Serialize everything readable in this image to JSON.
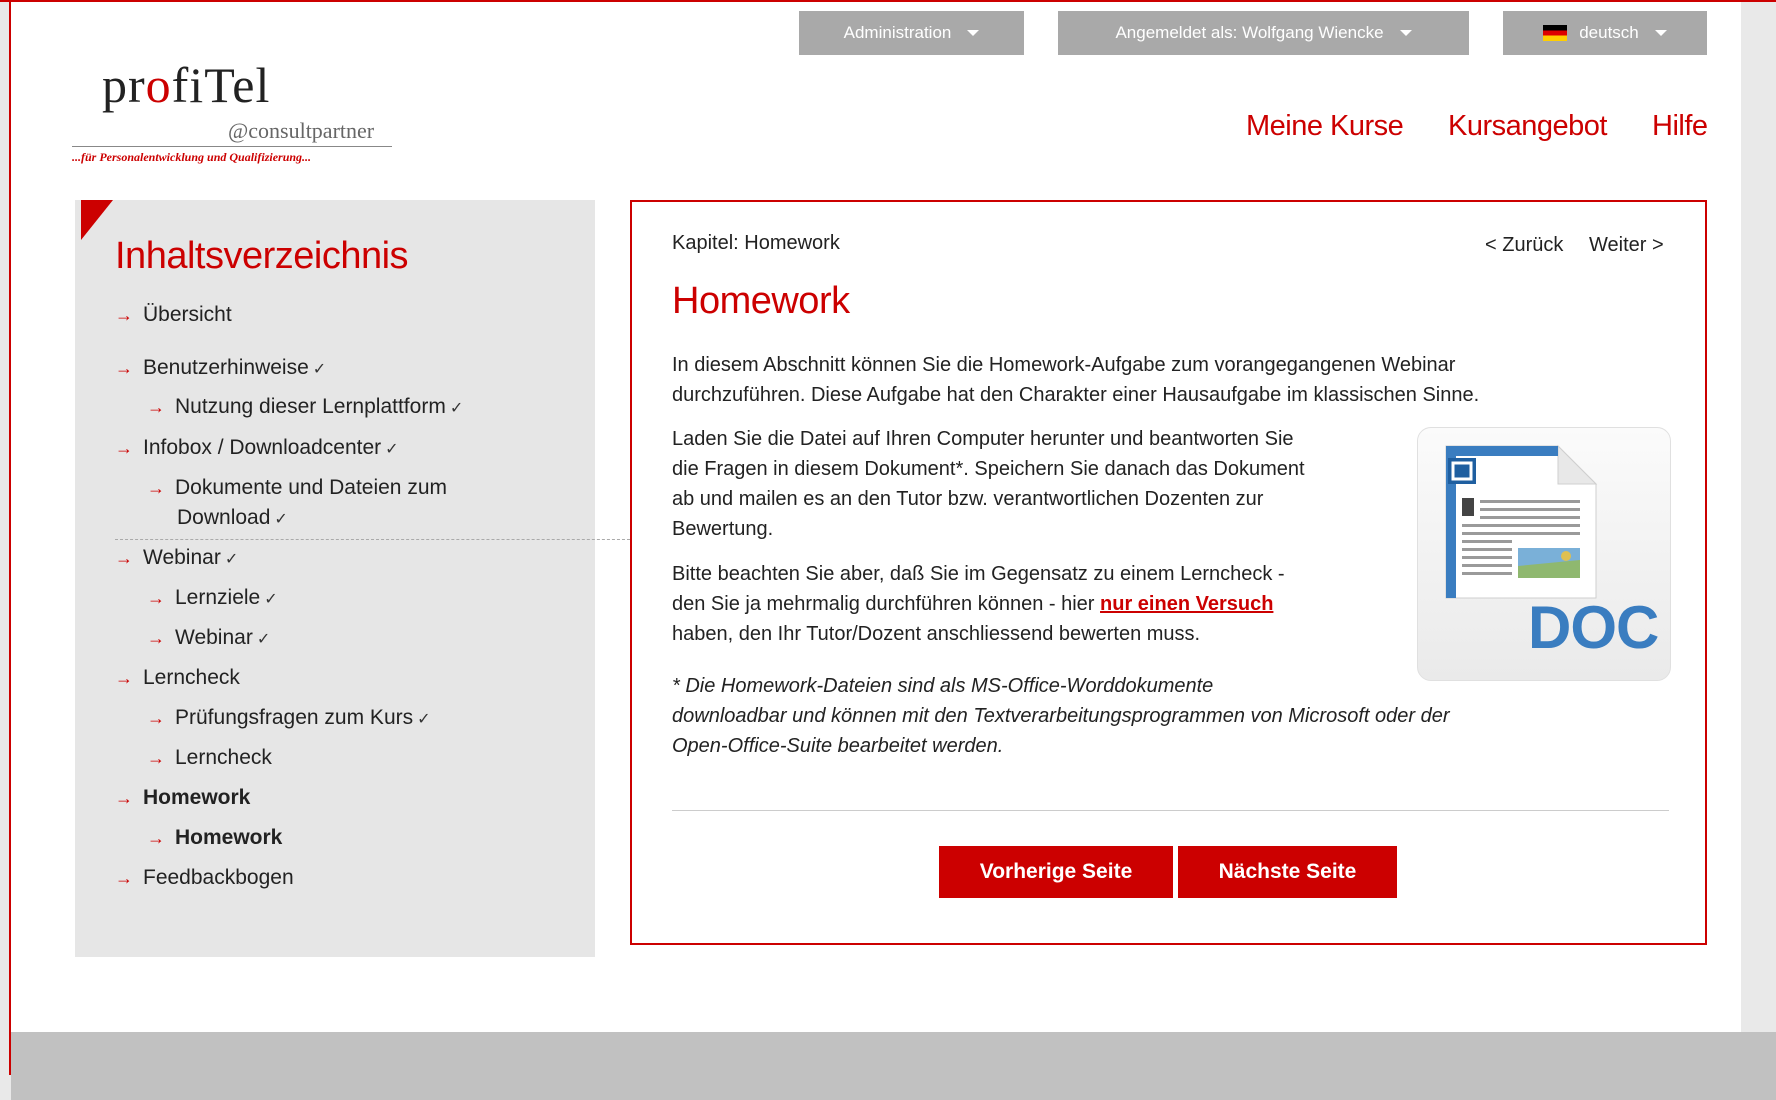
{
  "colors": {
    "brand_red": "#cc0000",
    "topbar_gray": "#a9a9a9",
    "sidebar_bg": "#e6e6e6",
    "footer_gray": "#c1c1c1"
  },
  "topbar": {
    "admin_label": "Administration",
    "user_label": "Angemeldet als: Wolfgang Wiencke",
    "language_label": "deutsch",
    "language_flag_icon": "german-flag-icon"
  },
  "logo": {
    "brand_prefix": "pr",
    "brand_o": "o",
    "brand_suffix": "fiTel",
    "sub": "@consultpartner",
    "tagline": "...für Personalentwicklung und Qualifizierung..."
  },
  "nav": {
    "meine_kurse": "Meine Kurse",
    "kursangebot": "Kursangebot",
    "hilfe": "Hilfe"
  },
  "sidebar": {
    "title": "Inhaltsverzeichnis",
    "items": [
      {
        "label": "Übersicht",
        "check": ""
      },
      {
        "label": "Benutzerhinweise",
        "check": "✓"
      },
      {
        "label": "Nutzung dieser Lernplattform",
        "check": "✓"
      },
      {
        "label": "Infobox / Downloadcenter",
        "check": "✓"
      },
      {
        "label": "Dokumente und Dateien zum",
        "label2": "Download",
        "check": "✓"
      },
      {
        "label": "Webinar",
        "check": "✓"
      },
      {
        "label": "Lernziele",
        "check": "✓"
      },
      {
        "label": "Webinar",
        "check": "✓"
      },
      {
        "label": "Lerncheck",
        "check": ""
      },
      {
        "label": "Prüfungsfragen zum Kurs",
        "check": "✓"
      },
      {
        "label": "Lerncheck",
        "check": ""
      },
      {
        "label": "Homework",
        "check": ""
      },
      {
        "label": "Homework",
        "check": ""
      },
      {
        "label": "Feedbackbogen",
        "check": ""
      }
    ]
  },
  "content": {
    "chapter": "Kapitel: Homework",
    "nav_prev": "< Zurück",
    "nav_next": "Weiter >",
    "title": "Homework",
    "p1_line1": "In diesem Abschnitt können Sie die Homework-Aufgabe zum vorangegangenen Webinar",
    "p1_line2": "durchzuführen. Diese Aufgabe hat den Charakter einer Hausaufgabe im klassischen Sinne.",
    "p2_line1": "Laden Sie die Datei auf Ihren Computer herunter und beantworten Sie",
    "p2_line2": "die Fragen in diesem Dokument*. Speichern Sie danach das Dokument",
    "p2_line3": "ab und mailen es an den Tutor bzw. verantwortlichen Dozenten zur",
    "p2_line4": "Bewertung.",
    "p3_line1": "Bitte beachten Sie aber, daß Sie im Gegensatz zu einem Lerncheck -",
    "p3_line2_pre": "den Sie ja mehrmalig durchführen können - hier ",
    "p3_link": "nur einen Versuch",
    "p3_line3": "haben, den Ihr Tutor/Dozent anschliessend bewerten muss.",
    "p4_line1": "* Die Homework-Dateien sind als MS-Office-Worddokumente",
    "p4_line2": "downloadbar und können mit den  Textverarbeitungsprogrammen von Microsoft oder der",
    "p4_line3": "Open-Office-Suite bearbeitet werden.",
    "doc_icon_label": "DOC",
    "btn_prev": "Vorherige Seite",
    "btn_next": "Nächste Seite"
  }
}
